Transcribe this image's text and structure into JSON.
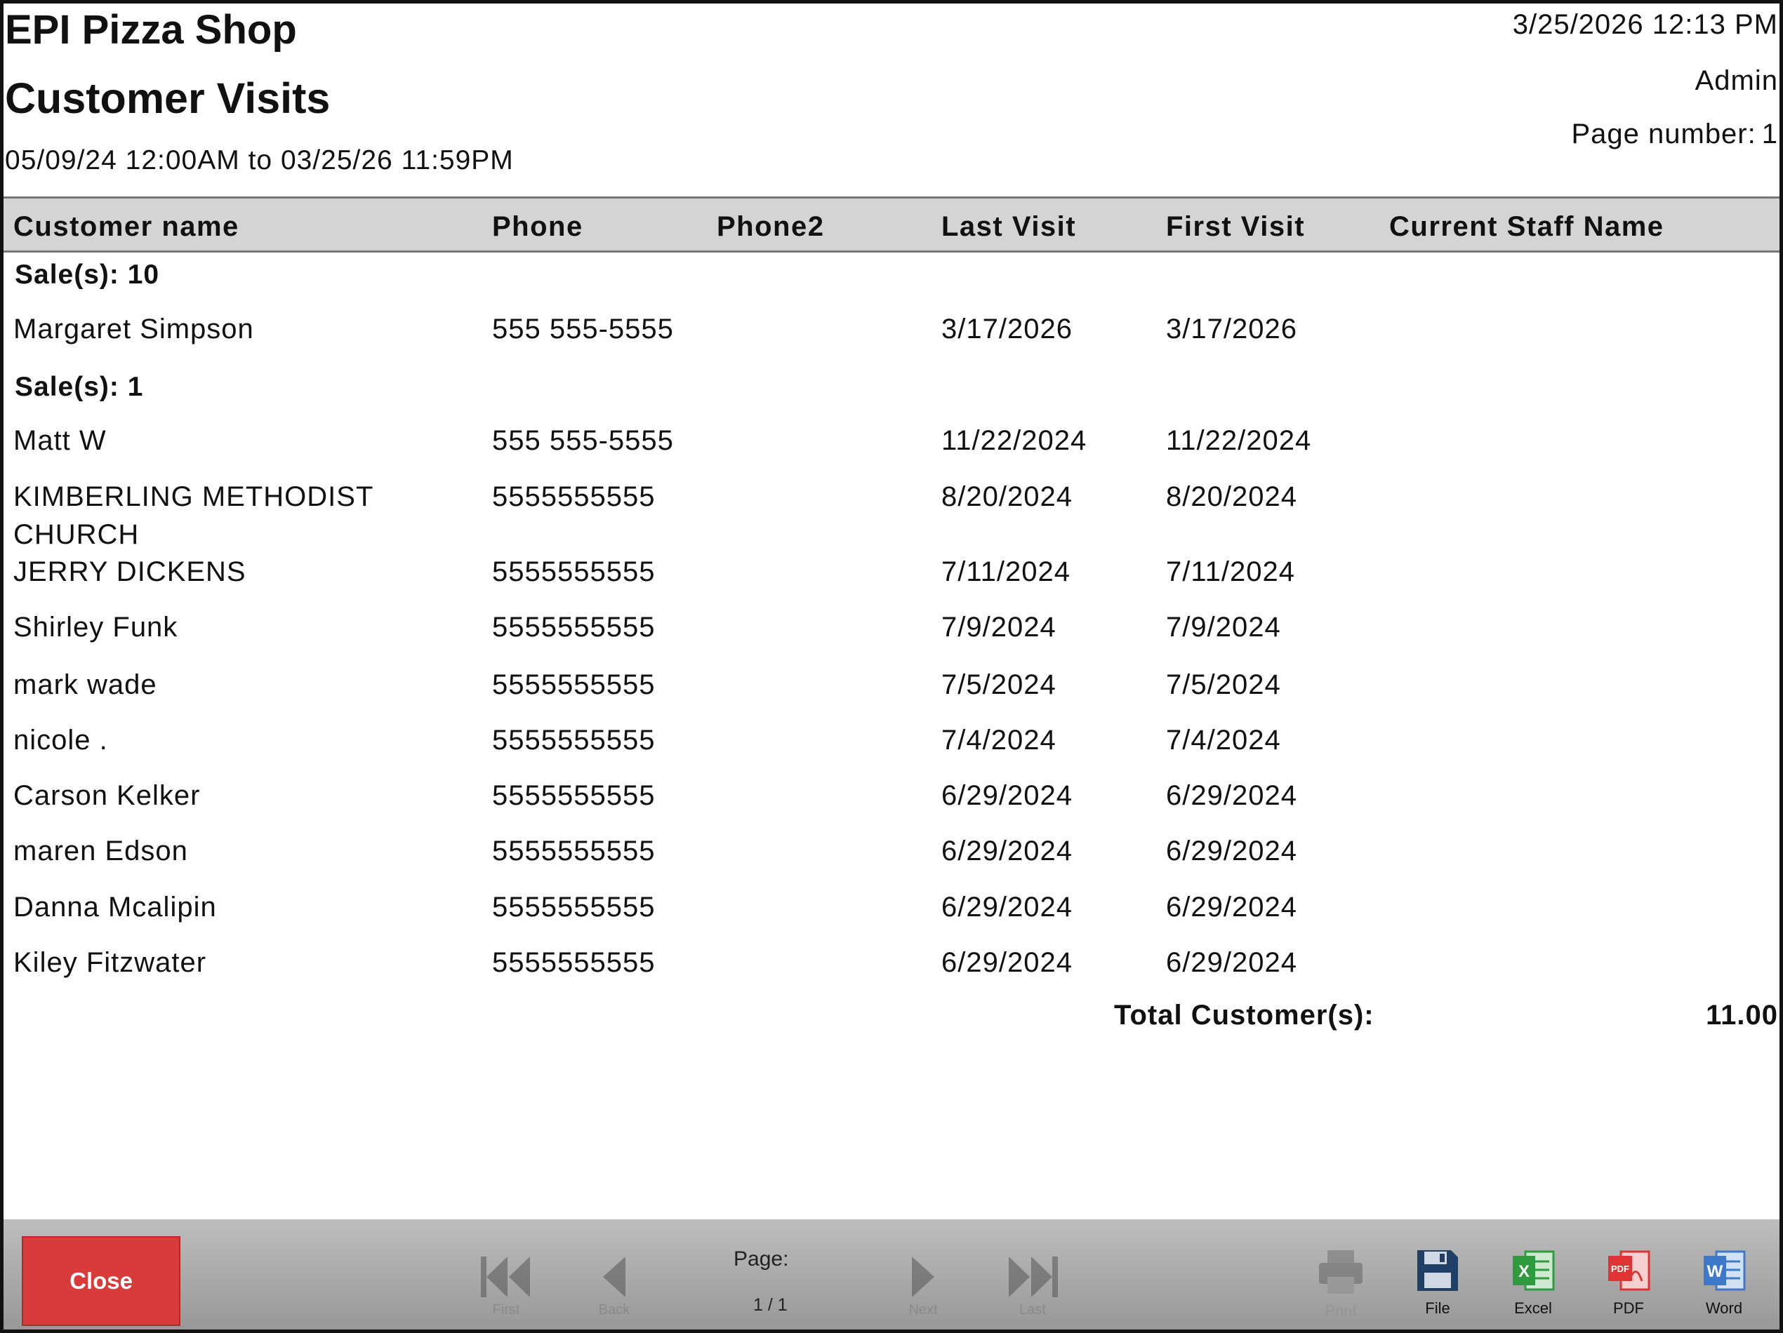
{
  "header": {
    "shop_name": "EPI Pizza Shop",
    "report_title": "Customer Visits",
    "date_range": "05/09/24 12:00AM to 03/25/26 11:59PM",
    "datetime": "3/25/2026 12:13 PM",
    "user": "Admin",
    "page_label": "Page number:",
    "page_value": "1"
  },
  "columns": [
    "Customer name",
    "Phone",
    "Phone2",
    "Last Visit",
    "First Visit",
    "Current Staff Name"
  ],
  "groups": [
    {
      "label": "Sale(s): 10",
      "rows": [
        {
          "name": "Margaret Simpson",
          "phone": "555 555-5555",
          "phone2": "",
          "last": "3/17/2026",
          "first": "3/17/2026",
          "staff": ""
        }
      ]
    },
    {
      "label": "Sale(s): 1",
      "rows": [
        {
          "name": "Matt W",
          "phone": "555 555-5555",
          "phone2": "",
          "last": "11/22/2024",
          "first": "11/22/2024",
          "staff": ""
        },
        {
          "name": "KIMBERLING METHODIST CHURCH",
          "phone": "5555555555",
          "phone2": "",
          "last": "8/20/2024",
          "first": "8/20/2024",
          "staff": ""
        },
        {
          "name": "JERRY DICKENS",
          "phone": "5555555555",
          "phone2": "",
          "last": "7/11/2024",
          "first": "7/11/2024",
          "staff": ""
        },
        {
          "name": "Shirley Funk",
          "phone": "5555555555",
          "phone2": "",
          "last": "7/9/2024",
          "first": "7/9/2024",
          "staff": ""
        },
        {
          "name": "mark wade",
          "phone": "5555555555",
          "phone2": "",
          "last": "7/5/2024",
          "first": "7/5/2024",
          "staff": ""
        },
        {
          "name": "nicole .",
          "phone": "5555555555",
          "phone2": "",
          "last": "7/4/2024",
          "first": "7/4/2024",
          "staff": ""
        },
        {
          "name": "Carson Kelker",
          "phone": "5555555555",
          "phone2": "",
          "last": "6/29/2024",
          "first": "6/29/2024",
          "staff": ""
        },
        {
          "name": "maren Edson",
          "phone": "5555555555",
          "phone2": "",
          "last": "6/29/2024",
          "first": "6/29/2024",
          "staff": ""
        },
        {
          "name": "Danna Mcalipin",
          "phone": "5555555555",
          "phone2": "",
          "last": "6/29/2024",
          "first": "6/29/2024",
          "staff": ""
        },
        {
          "name": "Kiley Fitzwater",
          "phone": "5555555555",
          "phone2": "",
          "last": "6/29/2024",
          "first": "6/29/2024",
          "staff": ""
        }
      ]
    }
  ],
  "total": {
    "label": "Total Customer(s):",
    "value": "11.00"
  },
  "footer": {
    "close_label": "Close",
    "page_label": "Page:",
    "page_value": "1 / 1",
    "nav": [
      {
        "icon": "first-page-icon",
        "label": "First"
      },
      {
        "icon": "previous-page-icon",
        "label": "Back"
      },
      {
        "icon": "next-page-icon",
        "label": "Next"
      },
      {
        "icon": "last-page-icon",
        "label": "Last"
      }
    ],
    "tools": [
      {
        "icon": "print-icon",
        "label": "Print"
      },
      {
        "icon": "save-file-icon",
        "label": "File"
      },
      {
        "icon": "excel-icon",
        "label": "Excel"
      },
      {
        "icon": "pdf-icon",
        "label": "PDF"
      },
      {
        "icon": "word-icon",
        "label": "Word"
      }
    ]
  },
  "colors": {
    "close": "#d93a3a",
    "header_row": "#d4d4d4",
    "excel": "#2e9b3f",
    "pdf": "#e03434",
    "word": "#3d78c9",
    "file": "#1f3f66"
  }
}
